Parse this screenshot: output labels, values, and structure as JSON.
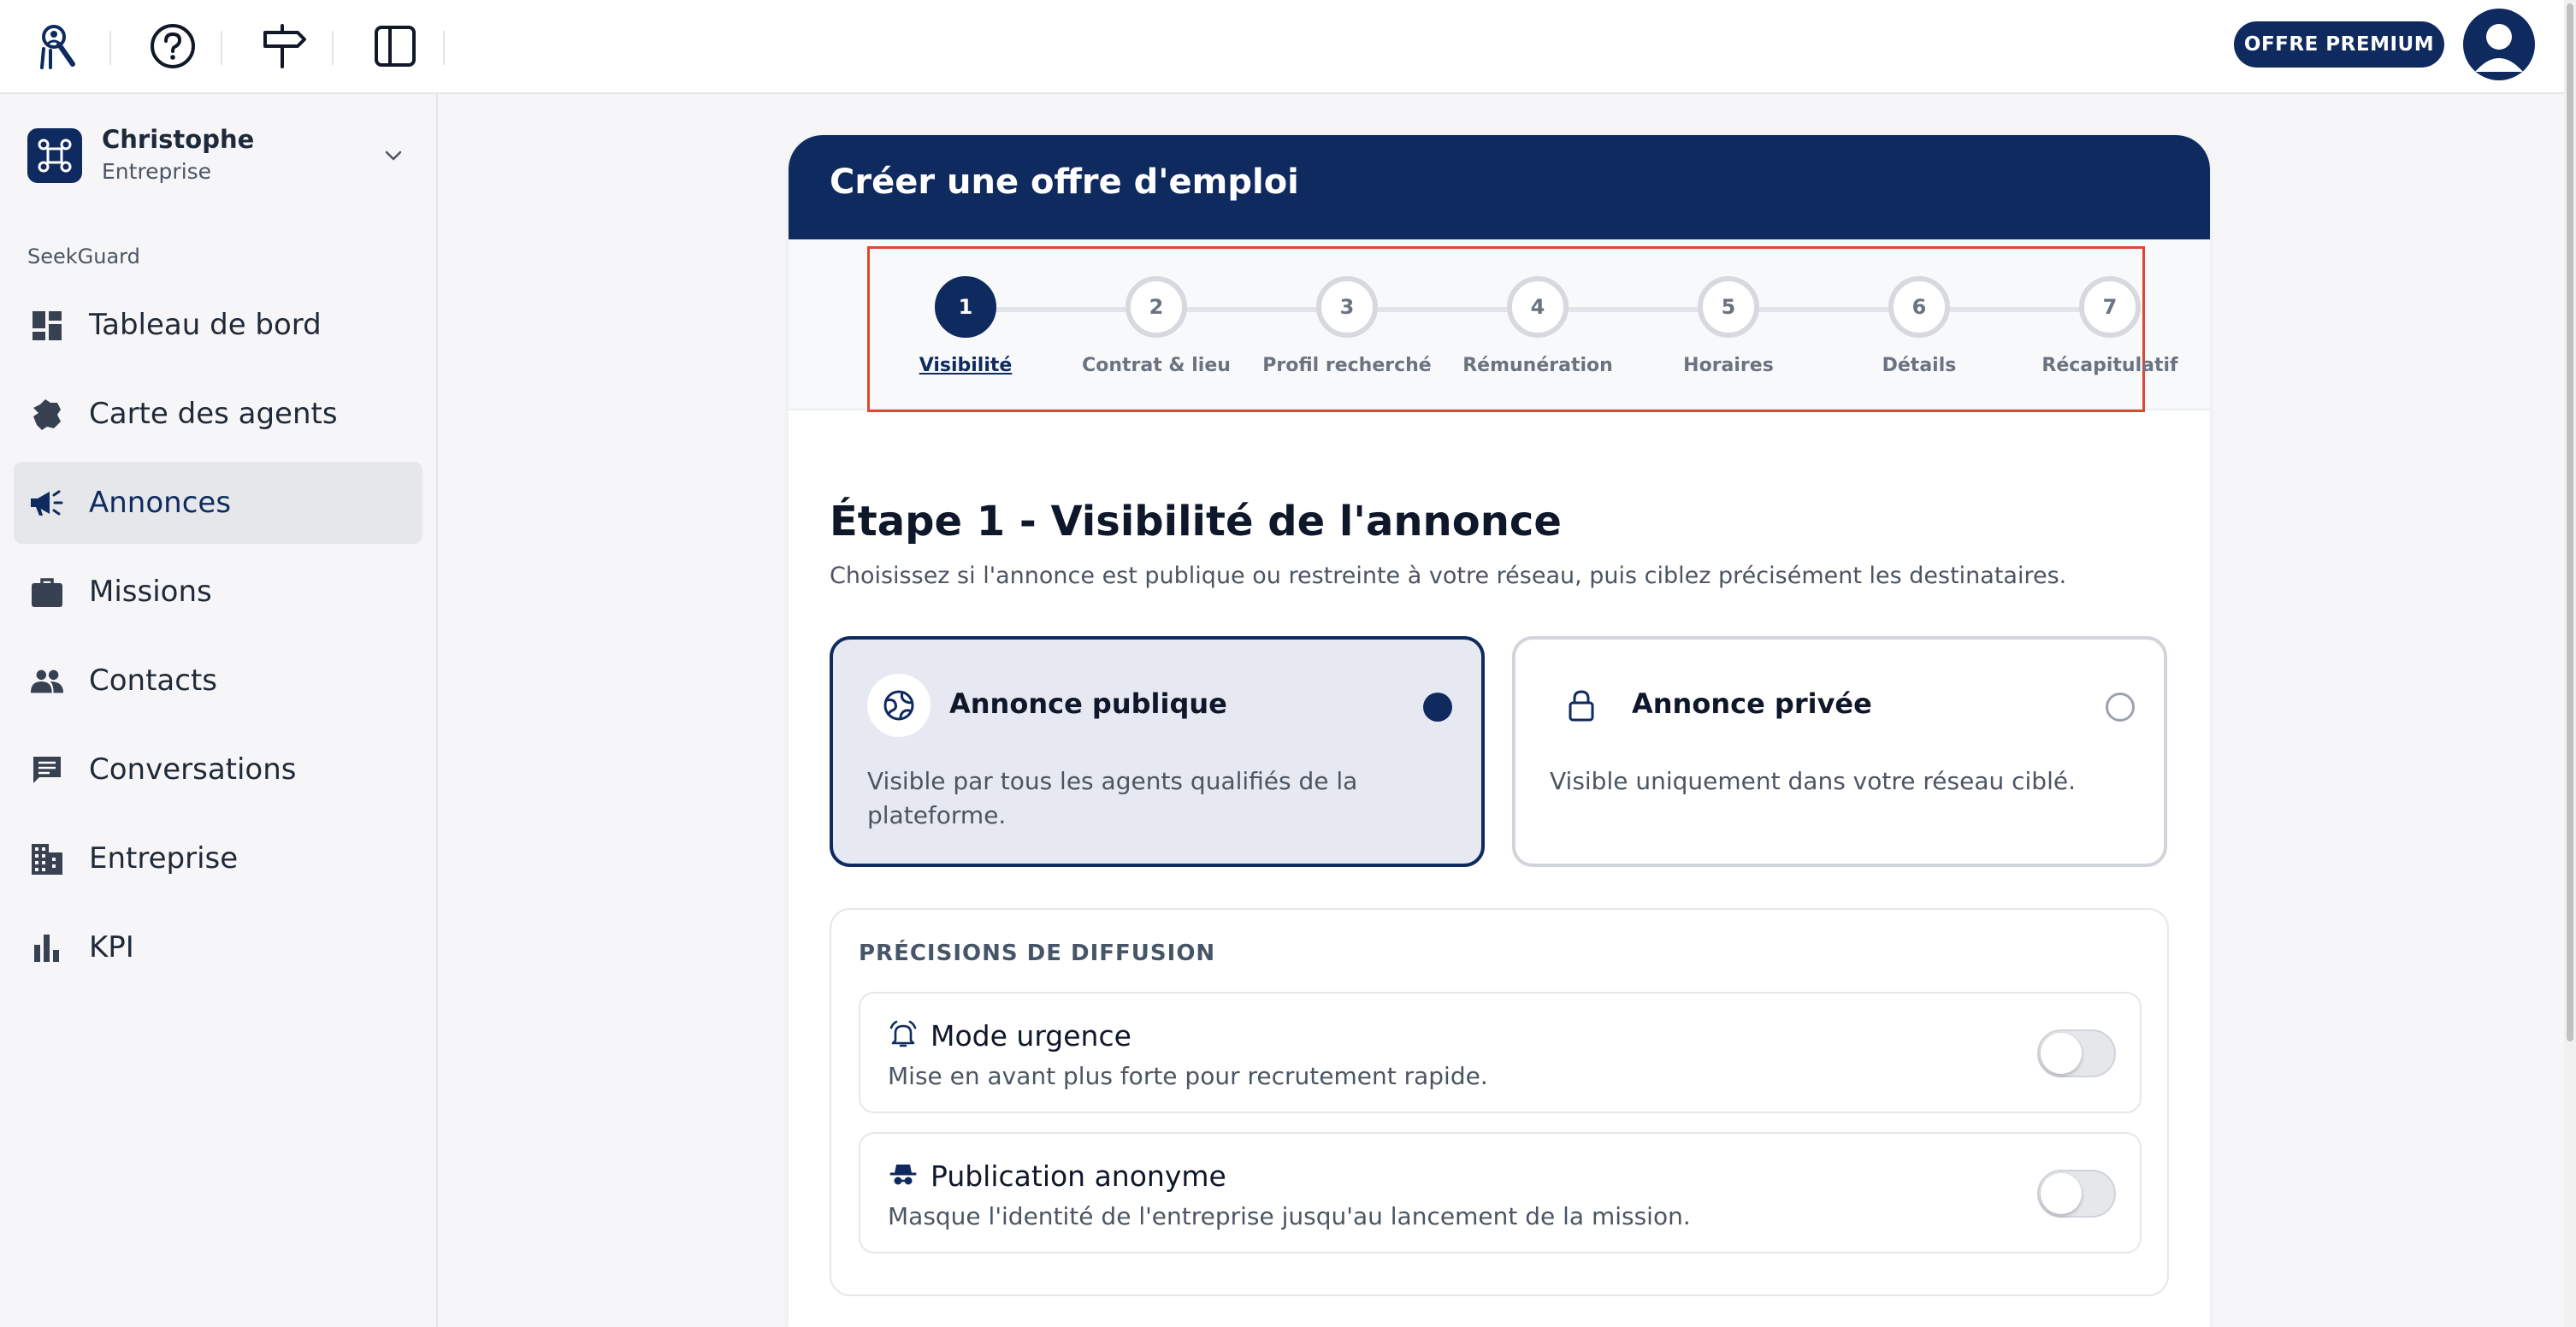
{
  "topbar": {
    "icons": [
      "agent-logo-icon",
      "help-icon",
      "signpost-icon",
      "sidebar-toggle-icon"
    ],
    "premium_label": "OFFRE PREMIUM"
  },
  "account": {
    "name": "Christophe",
    "type": "Entreprise"
  },
  "sidebar": {
    "section_label": "SeekGuard",
    "items": [
      {
        "label": "Tableau de bord",
        "icon": "dashboard-icon",
        "active": false
      },
      {
        "label": "Carte des agents",
        "icon": "france-map-icon",
        "active": false
      },
      {
        "label": "Annonces",
        "icon": "megaphone-icon",
        "active": true
      },
      {
        "label": "Missions",
        "icon": "briefcase-icon",
        "active": false
      },
      {
        "label": "Contacts",
        "icon": "people-icon",
        "active": false
      },
      {
        "label": "Conversations",
        "icon": "chat-icon",
        "active": false
      },
      {
        "label": "Entreprise",
        "icon": "building-icon",
        "active": false
      },
      {
        "label": "KPI",
        "icon": "bar-chart-icon",
        "active": false
      }
    ]
  },
  "form": {
    "title": "Créer une offre d'emploi",
    "steps": [
      {
        "number": "1",
        "label": "Visibilité",
        "active": true
      },
      {
        "number": "2",
        "label": "Contrat & lieu",
        "active": false
      },
      {
        "number": "3",
        "label": "Profil recherché",
        "active": false
      },
      {
        "number": "4",
        "label": "Rémunération",
        "active": false
      },
      {
        "number": "5",
        "label": "Horaires",
        "active": false
      },
      {
        "number": "6",
        "label": "Détails",
        "active": false
      },
      {
        "number": "7",
        "label": "Récapitulatif",
        "active": false
      }
    ],
    "step_title": "Étape 1 - Visibilité de l'annonce",
    "step_description": "Choisissez si l'annonce est publique ou restreinte à votre réseau, puis ciblez précisément les destinataires.",
    "visibility_options": [
      {
        "title": "Annonce publique",
        "description": "Visible par tous les agents qualifiés de la plateforme.",
        "selected": true,
        "icon": "globe-icon"
      },
      {
        "title": "Annonce privée",
        "description": "Visible uniquement dans votre réseau ciblé.",
        "selected": false,
        "icon": "lock-icon"
      }
    ],
    "diffusion": {
      "title": "PRÉCISIONS DE DIFFUSION",
      "options": [
        {
          "title": "Mode urgence",
          "description": "Mise en avant plus forte pour recrutement rapide.",
          "enabled": false,
          "icon": "alarm-bell-icon"
        },
        {
          "title": "Publication anonyme",
          "description": "Masque l'identité de l'entreprise jusqu'au lancement de la mission.",
          "enabled": false,
          "icon": "incognito-icon"
        }
      ]
    }
  },
  "colors": {
    "primary": "#0f2a5f",
    "highlight_border": "#e0452f",
    "sidebar_bg": "#f6f6f8"
  }
}
